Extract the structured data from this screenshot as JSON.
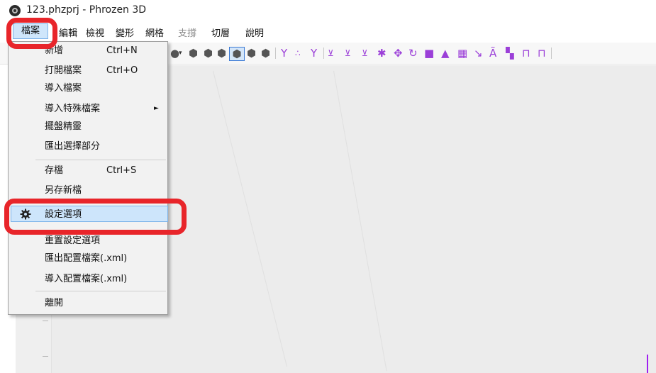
{
  "window": {
    "title": "123.phzprj - Phrozen 3D"
  },
  "menubar": {
    "items": [
      {
        "label": "檔案"
      },
      {
        "label": "編輯"
      },
      {
        "label": "檢視"
      },
      {
        "label": "變形"
      },
      {
        "label": "網格"
      },
      {
        "label": "支撐"
      },
      {
        "label": "切層"
      },
      {
        "label": "說明"
      }
    ]
  },
  "file_menu": {
    "items": [
      {
        "label": "新增",
        "shortcut": "Ctrl+N"
      },
      {
        "label": "打開檔案",
        "shortcut": "Ctrl+O"
      },
      {
        "label": "導入檔案"
      },
      {
        "label": "導入特殊檔案",
        "submenu": "►"
      },
      {
        "label": "擺盤精靈"
      },
      {
        "label": "匯出選擇部分"
      },
      {
        "label": "存檔",
        "shortcut": "Ctrl+S"
      },
      {
        "label": "另存新檔"
      },
      {
        "label": "設定選項",
        "icon": "gear-icon",
        "highlighted": true
      },
      {
        "label": "重置設定選項"
      },
      {
        "label": "匯出配置檔案(.xml)"
      },
      {
        "label": "導入配置檔案(.xml)"
      },
      {
        "label": "離開"
      }
    ]
  },
  "toolbar": {
    "icons": [
      "cube-dark-icon",
      "cube-dark-icon",
      "cube-selected-icon",
      "cube-dark-icon",
      "cube-dark-icon",
      "support-y-icon",
      "dots-icon",
      "support-y-icon",
      "layer-icon",
      "layer-icon",
      "layer-icon",
      "scale-star-icon",
      "move-icon",
      "rotate-icon",
      "square-icon",
      "mirror-icon",
      "grid-icon",
      "arrow-icon",
      "auto-support-icon",
      "hollow-icon",
      "frame-icon",
      "frame-icon"
    ]
  },
  "colors": {
    "accent_highlight": "#cde5fb",
    "callout": "#e8252a",
    "toolbar_purple": "#9b3fd8",
    "toolbar_blue": "#3a79d4"
  }
}
